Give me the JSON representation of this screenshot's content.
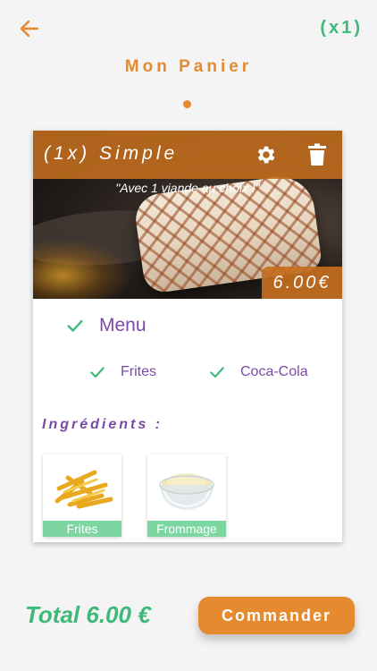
{
  "header": {
    "back_icon": "arrow-left-icon",
    "count": "(x1)",
    "title": "Mon Panier"
  },
  "item": {
    "title": "(1x) Simple",
    "tagline": "\"Avec 1 viande au choix !\"",
    "price": "6.00€",
    "actions": [
      "gear-icon",
      "trash-icon"
    ]
  },
  "menu": {
    "label": "Menu",
    "options": [
      "Frites",
      "Coca-Cola"
    ]
  },
  "ingredients": {
    "title": "Ingrédients :",
    "items": [
      "Frites",
      "Frommage"
    ]
  },
  "footer": {
    "total": "Total  6.00 €",
    "order_label": "Commander"
  },
  "colors": {
    "accent": "#e58a2e",
    "green": "#3fb97a",
    "purple": "#7b4aa6",
    "chip": "#7dd6a1"
  }
}
